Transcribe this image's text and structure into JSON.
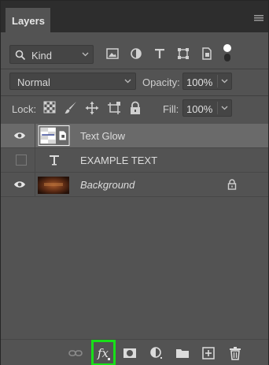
{
  "panel": {
    "tab_label": "Layers",
    "menu_icon": "panel-menu-icon"
  },
  "filter": {
    "kind_label": "Kind",
    "icons": [
      "image-filter-icon",
      "adjustment-filter-icon",
      "type-filter-icon",
      "shape-filter-icon",
      "smart-object-filter-icon",
      "filter-toggle-icon"
    ]
  },
  "blend": {
    "mode": "Normal",
    "opacity_label": "Opacity:",
    "opacity_value": "100%"
  },
  "lock": {
    "label": "Lock:",
    "fill_label": "Fill:",
    "fill_value": "100%",
    "icons": [
      "lock-transparent-pixels-icon",
      "lock-image-pixels-icon",
      "lock-position-icon",
      "lock-artboard-icon",
      "lock-all-icon"
    ]
  },
  "layers": [
    {
      "name": "Text Glow",
      "visible": true,
      "selected": true,
      "kind": "smart-object",
      "italic": false,
      "locked": false
    },
    {
      "name": "EXAMPLE TEXT",
      "visible": false,
      "selected": false,
      "kind": "type",
      "italic": false,
      "locked": false
    },
    {
      "name": "Background",
      "visible": true,
      "selected": false,
      "kind": "image",
      "italic": true,
      "locked": true
    }
  ],
  "bottom_bar": {
    "fx_label": "fx",
    "icons": [
      "link-layers-icon",
      "fx-icon",
      "add-mask-icon",
      "new-adjustment-layer-icon",
      "new-group-icon",
      "new-layer-icon",
      "delete-layer-icon"
    ]
  },
  "colors": {
    "panel_bg": "#535353",
    "tabbar_bg": "#2d2d2d",
    "selected_row": "#6a6a6a",
    "highlight": "#18e018"
  }
}
